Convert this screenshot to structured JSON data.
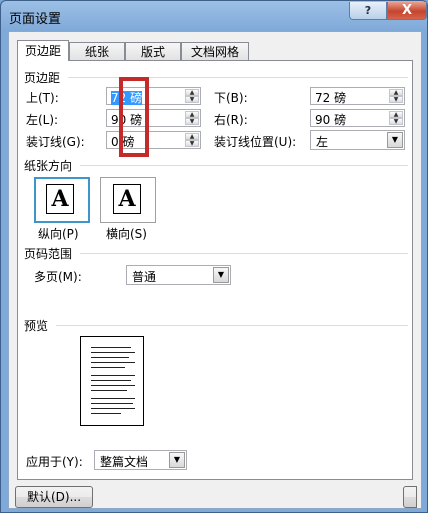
{
  "window": {
    "title": "页面设置",
    "help_glyph": "?",
    "close_glyph": "X"
  },
  "tabs": [
    {
      "label": "页边距",
      "active": true
    },
    {
      "label": "纸张",
      "active": false
    },
    {
      "label": "版式",
      "active": false
    },
    {
      "label": "文档网格",
      "active": false
    }
  ],
  "margins": {
    "section_title": "页边距",
    "top": {
      "label": "上(T):",
      "value": "72 磅"
    },
    "bottom": {
      "label": "下(B):",
      "value": "72 磅"
    },
    "left": {
      "label": "左(L):",
      "value": "90 磅"
    },
    "right": {
      "label": "右(R):",
      "value": "90 磅"
    },
    "gutter": {
      "label": "装订线(G):",
      "value": "0 磅"
    },
    "gutter_position": {
      "label": "装订线位置(U):",
      "value": "左"
    }
  },
  "orientation": {
    "section_title": "纸张方向",
    "portrait": {
      "label": "纵向(P)",
      "glyph": "A",
      "selected": true
    },
    "landscape": {
      "label": "横向(S)",
      "glyph": "A",
      "selected": false
    }
  },
  "pages": {
    "section_title": "页码范围",
    "multiple_label": "多页(M):",
    "multiple_value": "普通"
  },
  "preview": {
    "section_title": "预览",
    "apply_label": "应用于(Y):",
    "apply_value": "整篇文档"
  },
  "footer": {
    "default_button": "默认(D)..."
  },
  "colors": {
    "highlight": "#c42a2a",
    "selection": "#3399ff"
  }
}
